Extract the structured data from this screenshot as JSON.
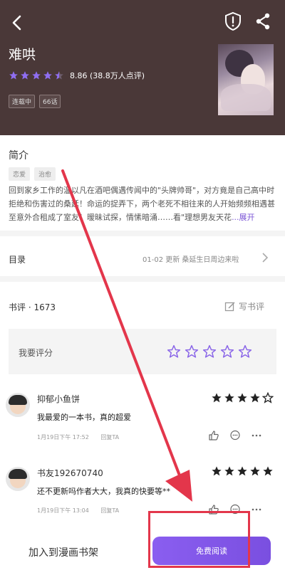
{
  "header": {
    "title": "难哄",
    "rating_text": "8.86 (38.8万人点评)",
    "rating_stars": 4.5,
    "tags": [
      "连载中",
      "66话"
    ],
    "bg_color": "#4a3838"
  },
  "synopsis": {
    "title": "简介",
    "genre_tags": [
      "恋爱",
      "治愈"
    ],
    "line1": "回到家乡工作的温以凡在酒吧偶遇传闻中的\"头牌帅哥\"，对方竟是自己高中时",
    "line2": "拒绝和伤害过的桑延！命运的捉弄下，两个老死不相往来的人开始频频相遇甚",
    "line3": "至意外合租成了室友！暧昧试探，情愫暗涌……看\"理想男友天花",
    "expand": "...展开"
  },
  "toc": {
    "label": "目录",
    "update": "01-02 更新  桑延生日周边来啦"
  },
  "reviews": {
    "title": "书评 · 1673",
    "write_label": "写书评",
    "rate_label": "我要评分",
    "items": [
      {
        "user": "抑郁小鱼饼",
        "stars": 4,
        "text": "我最爱的一本书，真的超爱",
        "time": "1月19日下午 17:52",
        "reply": "回复TA"
      },
      {
        "user": "书友192670740",
        "stars": 5,
        "text": "还不更新吗作者大大，我真的快要等**",
        "time": "1月19日下午 13:04",
        "reply": "回复TA"
      }
    ]
  },
  "bottom": {
    "add_shelf": "加入到漫画书架",
    "read_button": "免费阅读"
  },
  "colors": {
    "accent": "#7b55d6",
    "annotation_red": "#e3364b"
  }
}
